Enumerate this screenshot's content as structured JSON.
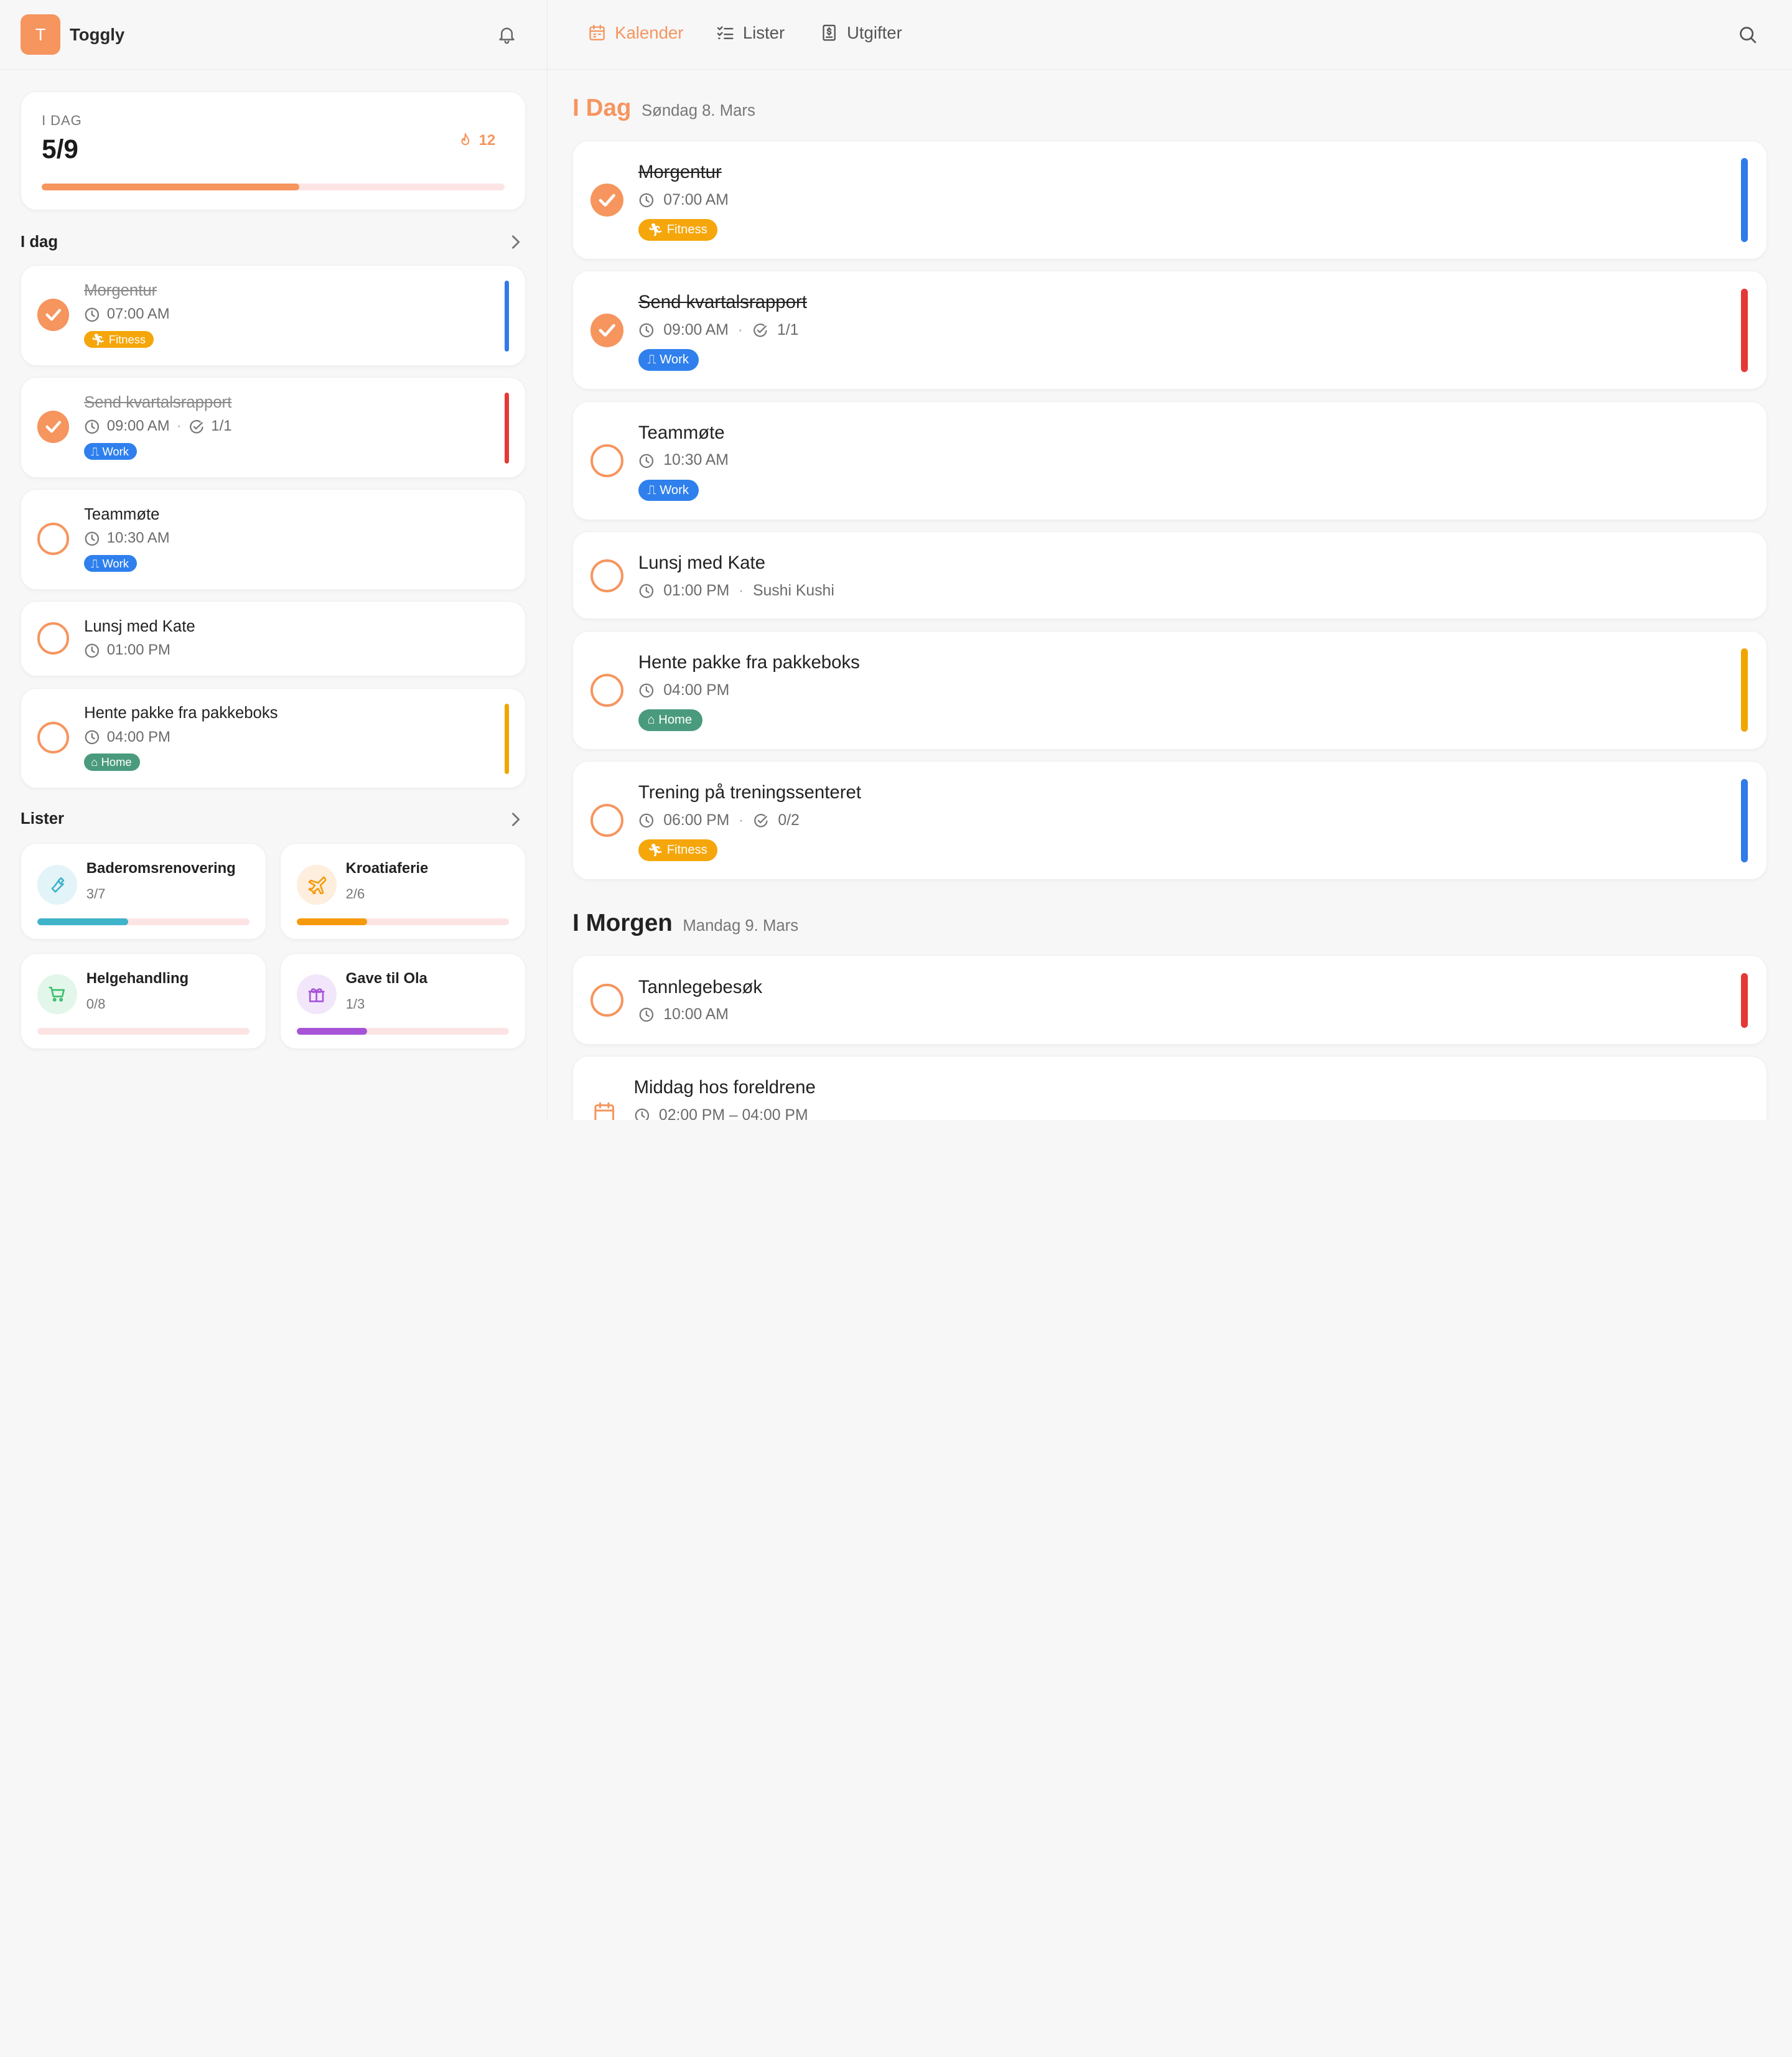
{
  "app": {
    "avatar_letter": "T",
    "name": "Toggly"
  },
  "today_summary": {
    "label": "I DAG",
    "count": "5/9",
    "progress": 0.556,
    "streak": "12"
  },
  "sidebar": {
    "today_section": "I dag",
    "tasks": [
      {
        "title": "Morgentur",
        "time": "07:00 AM",
        "done": true,
        "tag": "Fitness",
        "color": "#2f7be8"
      },
      {
        "title": "Send kvartalsrapport",
        "time": "09:00 AM",
        "subtasks": "1/1",
        "done": true,
        "tag": "Work",
        "color": "#e53935"
      },
      {
        "title": "Teammøte",
        "time": "10:30 AM",
        "done": false,
        "tag": "Work"
      },
      {
        "title": "Lunsj med Kate",
        "time": "01:00 PM",
        "done": false
      },
      {
        "title": "Hente pakke fra pakkeboks",
        "time": "04:00 PM",
        "done": false,
        "tag": "Home",
        "color": "#f0a500"
      }
    ],
    "lists_section": "Lister",
    "lists": [
      {
        "name": "Baderomsrenovering",
        "count": "3/7",
        "progress": 0.4286,
        "color": "#3fb3c9",
        "icon": "wrench-icon"
      },
      {
        "name": "Kroatiaferie",
        "count": "2/6",
        "progress": 0.3333,
        "color": "#f59a0c",
        "icon": "plane-icon"
      },
      {
        "name": "Helgehandling",
        "count": "0/8",
        "progress": 0,
        "color": "#3bbf6d",
        "icon": "cart-icon"
      },
      {
        "name": "Gave til Ola",
        "count": "1/3",
        "progress": 0.3333,
        "color": "#a653d8",
        "icon": "gift-icon"
      }
    ]
  },
  "nav": {
    "calendar": "Kalender",
    "lists": "Lister",
    "expenses": "Utgifter"
  },
  "main": {
    "today": {
      "name": "I Dag",
      "date": "Søndag 8. Mars"
    },
    "today_tasks": [
      {
        "title": "Morgentur",
        "time": "07:00 AM",
        "done": true,
        "tag": "Fitness",
        "color": "#2f7be8"
      },
      {
        "title": "Send kvartalsrapport",
        "time": "09:00 AM",
        "subtasks": "1/1",
        "done": true,
        "tag": "Work",
        "color": "#e53935"
      },
      {
        "title": "Teammøte",
        "time": "10:30 AM",
        "done": false,
        "tag": "Work"
      },
      {
        "title": "Lunsj med Kate",
        "time": "01:00 PM",
        "location": "Sushi Kushi",
        "done": false
      },
      {
        "title": "Hente pakke fra pakkeboks",
        "time": "04:00 PM",
        "done": false,
        "tag": "Home",
        "color": "#f0a500"
      },
      {
        "title": "Trening på treningssenteret",
        "time": "06:00 PM",
        "subtasks": "0/2",
        "done": false,
        "tag": "Fitness",
        "color": "#2f7be8"
      }
    ],
    "tomorrow": {
      "name": "I Morgen",
      "date": "Mandag 9. Mars"
    },
    "tomorrow_tasks": [
      {
        "title": "Tannlegebesøk",
        "time": "10:00 AM",
        "done": false,
        "color": "#e53935"
      },
      {
        "title": "Middag hos foreldrene",
        "time": "02:00 PM – 04:00 PM"
      }
    ]
  },
  "colors": {
    "accent": "#f6955e",
    "fitness": "#f5a60a",
    "work": "#2f80ed",
    "home": "#4a9b7d"
  }
}
